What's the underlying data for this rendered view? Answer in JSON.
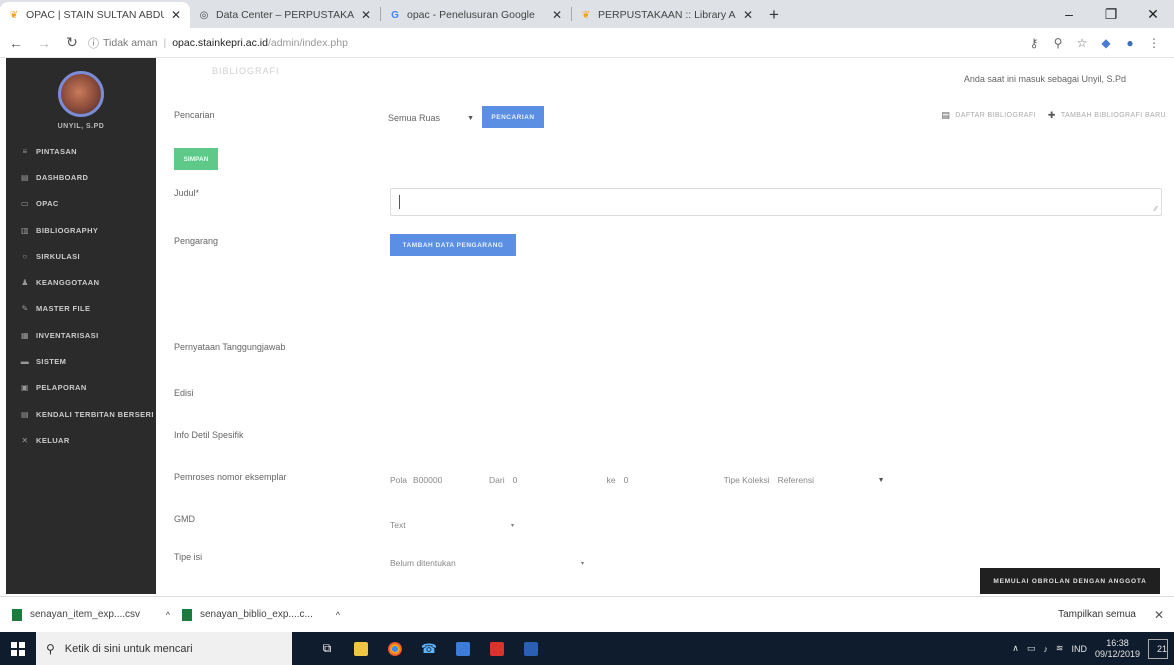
{
  "browser": {
    "tabs": [
      {
        "title": "OPAC | STAIN SULTAN ABDURRA",
        "favicon": "orange-leaf-icon",
        "active": true
      },
      {
        "title": "Data Center – PERPUSTAKAAN",
        "favicon": "globe-icon",
        "active": false
      },
      {
        "title": "opac - Penelusuran Google",
        "favicon": "google-icon",
        "active": false
      },
      {
        "title": "PERPUSTAKAAN :: Library Autor",
        "favicon": "orange-leaf-icon",
        "active": false
      }
    ],
    "address": {
      "security": "Tidak aman",
      "host": "opac.stainkepri.ac.id",
      "path": "/admin/index.php"
    }
  },
  "sidebar": {
    "user_name": "UNYIL, S.PD",
    "items": [
      {
        "label": "PINTASAN",
        "icon": "shortcut-icon"
      },
      {
        "label": "DASHBOARD",
        "icon": "dashboard-icon"
      },
      {
        "label": "OPAC",
        "icon": "monitor-icon"
      },
      {
        "label": "BIBLIOGRAPHY",
        "icon": "book-icon"
      },
      {
        "label": "SIRKULASI",
        "icon": "circulation-icon"
      },
      {
        "label": "KEANGGOTAAN",
        "icon": "members-icon"
      },
      {
        "label": "MASTER FILE",
        "icon": "master-file-icon"
      },
      {
        "label": "INVENTARISASI",
        "icon": "inventory-icon"
      },
      {
        "label": "SISTEM",
        "icon": "system-icon"
      },
      {
        "label": "PELAPORAN",
        "icon": "report-icon"
      },
      {
        "label": "KENDALI TERBITAN BERSERI",
        "icon": "serial-icon"
      },
      {
        "label": "KELUAR",
        "icon": "logout-icon"
      }
    ]
  },
  "main": {
    "heading": "BIBLIOGRAFI",
    "logged_in_text": "Anda saat ini masuk sebagai Unyil, S.Pd",
    "search": {
      "label": "Pencarian",
      "field_select": "Semua Ruas",
      "button": "PENCARIAN"
    },
    "top_links": {
      "list": "DAFTAR BIBLIOGRAFI",
      "add": "TAMBAH BIBLIOGRAFI BARU"
    },
    "save_button": "SIMPAN",
    "form": {
      "title_label": "Judul*",
      "author_label": "Pengarang",
      "add_author_button": "TAMBAH DATA PENGARANG",
      "responsibility_label": "Pernyataan Tanggungjawab",
      "edition_label": "Edisi",
      "specific_info_label": "Info Detil Spesifik",
      "item_code_label": "Pemroses nomor eksemplar",
      "pattern_label": "Pola",
      "pattern_value": "B00000",
      "from_label": "Dari",
      "from_value": "0",
      "to_label": "ke",
      "to_value": "0",
      "collection_type_label": "Tipe Koleksi",
      "collection_type_value": "Referensi",
      "gmd_label": "GMD",
      "gmd_value": "Text",
      "frequency_label": "Tipe isi",
      "frequency_value": "Belum ditentukan"
    },
    "chat_button": "MEMULAI OBROLAN DENGAN ANGGOTA"
  },
  "downloads": {
    "items": [
      {
        "name": "senayan_item_exp....csv"
      },
      {
        "name": "senayan_biblio_exp....c..."
      }
    ],
    "show_all": "Tampilkan semua"
  },
  "taskbar": {
    "search_placeholder": "Ketik di sini untuk mencari",
    "language": "IND",
    "time": "16:38",
    "date": "09/12/2019",
    "notification_count": "21"
  }
}
